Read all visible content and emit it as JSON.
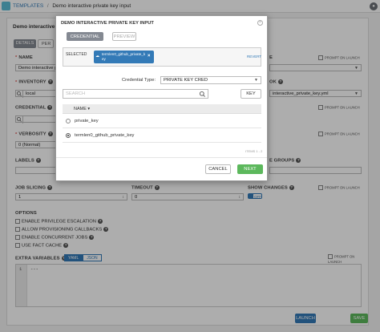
{
  "breadcrumb": {
    "root": "TEMPLATES",
    "separator": "/",
    "current": "Demo interactive private key input"
  },
  "page": {
    "title": "Demo interactive p",
    "tabs": [
      {
        "label": "DETAILS"
      },
      {
        "label": "PER"
      }
    ],
    "fields": {
      "name": {
        "label": "NAME",
        "value": "Demo interactive p"
      },
      "inventory": {
        "label": "INVENTORY",
        "value": "local"
      },
      "credential": {
        "label": "CREDENTIAL"
      },
      "verbosity": {
        "label": "VERBOSITY",
        "value": "0 (Normal)"
      },
      "labels": {
        "label": "LABELS"
      },
      "job_type_partial": {
        "label": "E"
      },
      "playbook_partial": {
        "label": "OK",
        "value": "interactive_private_key.yml"
      },
      "instance_groups_partial": {
        "label": "E GROUPS"
      },
      "job_slicing": {
        "label": "JOB SLICING",
        "value": "1"
      },
      "timeout": {
        "label": "TIMEOUT",
        "value": "0"
      },
      "show_changes": {
        "label": "SHOW CHANGES",
        "toggle": "OFF"
      }
    },
    "prompt_on_launch": "PROMPT ON LAUNCH",
    "options": {
      "label": "OPTIONS",
      "items": [
        "ENABLE PRIVILEGE ESCALATION",
        "ALLOW PROVISIONING CALLBACKS",
        "ENABLE CONCURRENT JOBS",
        "USE FACT CACHE"
      ]
    },
    "extra_variables": {
      "label": "EXTRA VARIABLES",
      "format_tabs": [
        "YAML",
        "JSON"
      ],
      "active_format": "YAML",
      "lines": [
        {
          "num": "1",
          "text": "---"
        }
      ]
    },
    "actions": {
      "launch": "LAUNCH",
      "save": "SAVE"
    }
  },
  "modal": {
    "title": "DEMO INTERACTIVE PRIVATE KEY INPUT",
    "tabs": [
      {
        "label": "CREDENTIAL"
      },
      {
        "label": "PREVIEW"
      }
    ],
    "selected": {
      "label": "SELECTED",
      "tag": "termlen0_github_private_key",
      "revert": "REVERT"
    },
    "credential_type": {
      "label": "Credential Type:",
      "value": "PRIVATE KEY CRED"
    },
    "search": {
      "placeholder": "SEARCH",
      "key_button": "KEY"
    },
    "list": {
      "header": "NAME",
      "rows": [
        {
          "name": "private_key",
          "checked": false
        },
        {
          "name": "termlen0_github_private_key",
          "checked": true
        }
      ],
      "items_count": "ITEMS 1 - 2"
    },
    "buttons": {
      "cancel": "CANCEL",
      "next": "NEXT"
    }
  },
  "colors": {
    "primary": "#337ab7",
    "success": "#5cb85c",
    "tab_active": "#848992",
    "required": "#d9534f"
  }
}
